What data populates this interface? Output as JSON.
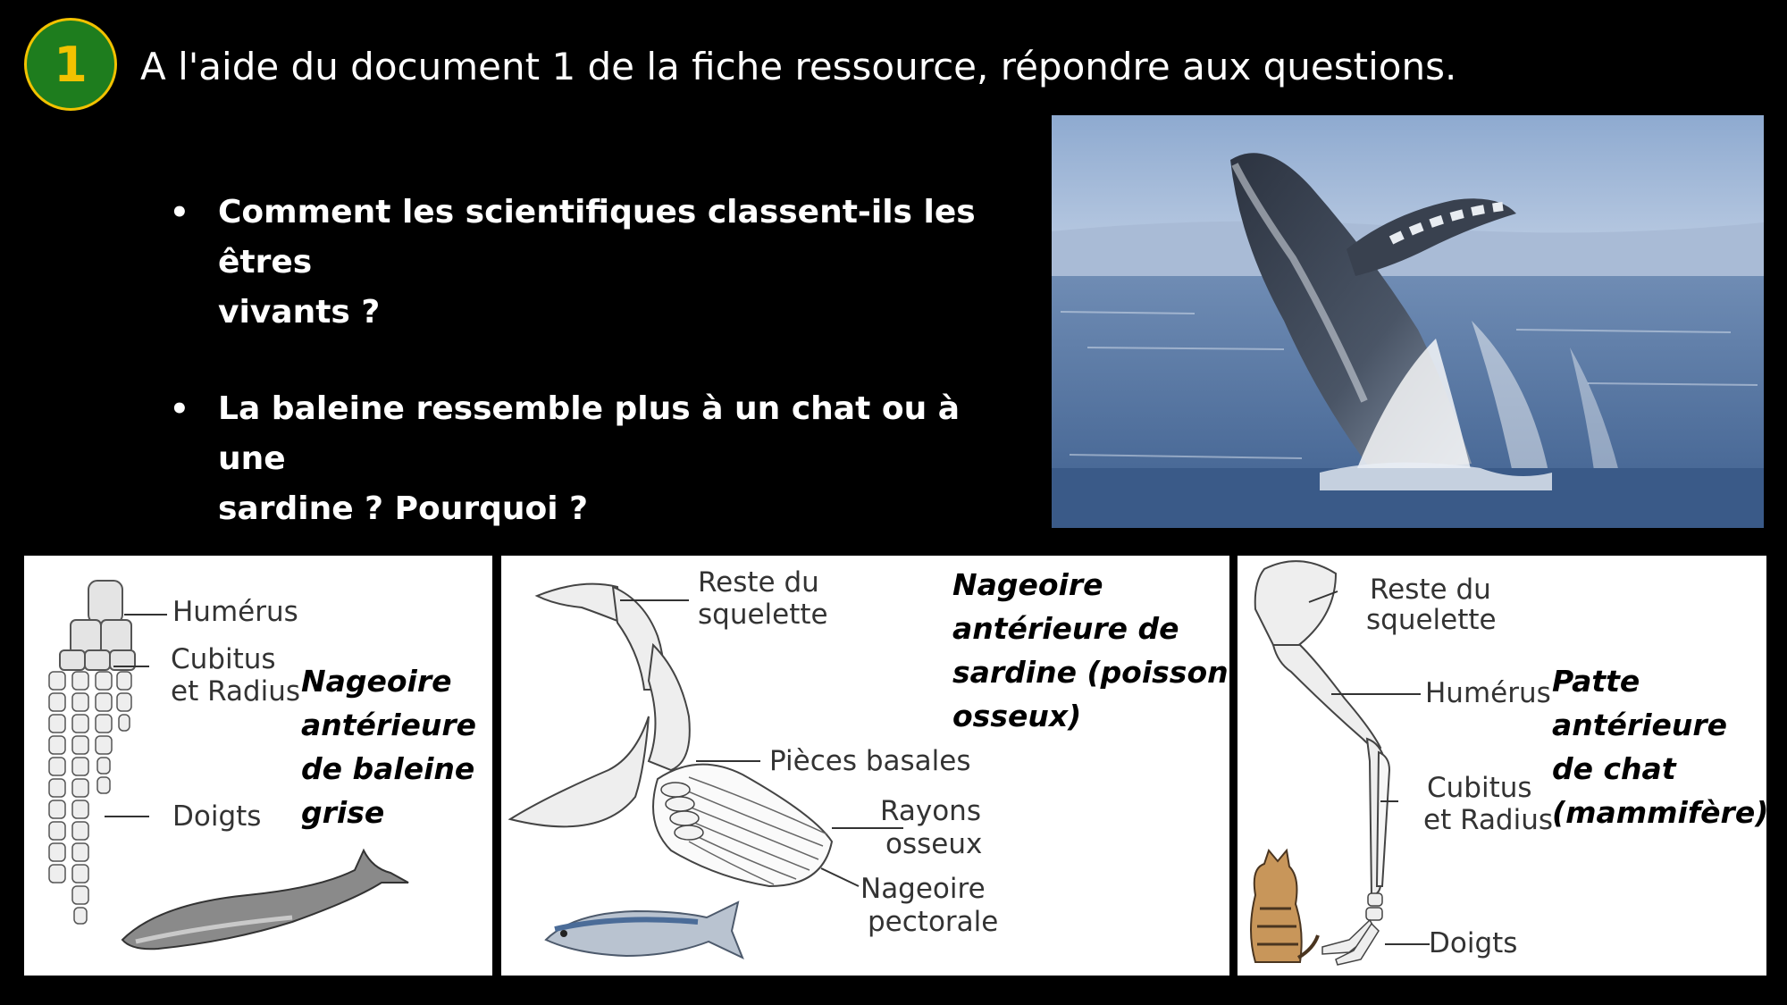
{
  "header": {
    "badge": "1",
    "title": "A l'aide du document 1 de la fiche ressource, répondre aux questions."
  },
  "questions": [
    {
      "bullet": "•",
      "line1": "Comment les scientifiques classent-ils les êtres",
      "line2": "vivants ?"
    },
    {
      "bullet": "•",
      "line1": "La baleine ressemble plus à un chat ou à une",
      "line2": "sardine ? Pourquoi ?"
    }
  ],
  "panels": {
    "whale": {
      "labels": [
        "Humérus",
        "Cubitus",
        "et Radius",
        "Doigts"
      ],
      "caption": [
        "Nageoire",
        "antérieure",
        "de baleine",
        "grise"
      ]
    },
    "sardine": {
      "labels": [
        "Reste du",
        "squelette",
        "Pièces basales",
        "Rayons",
        "osseux",
        "Nageoire",
        "pectorale"
      ],
      "caption": [
        "Nageoire",
        "antérieure de",
        "sardine (poisson",
        "osseux)"
      ]
    },
    "cat": {
      "labels": [
        "Reste du",
        "squelette",
        "Humérus",
        "Cubitus",
        "et Radius",
        "Doigts"
      ],
      "caption": [
        "Patte",
        "antérieure",
        "de chat",
        "(mammifère)"
      ]
    }
  },
  "colors": {
    "background": "#000000",
    "badge_fill": "#1e7d1e",
    "badge_text": "#f2c200",
    "sky": "#9fb6d6",
    "sea": "#4f6f9a"
  }
}
